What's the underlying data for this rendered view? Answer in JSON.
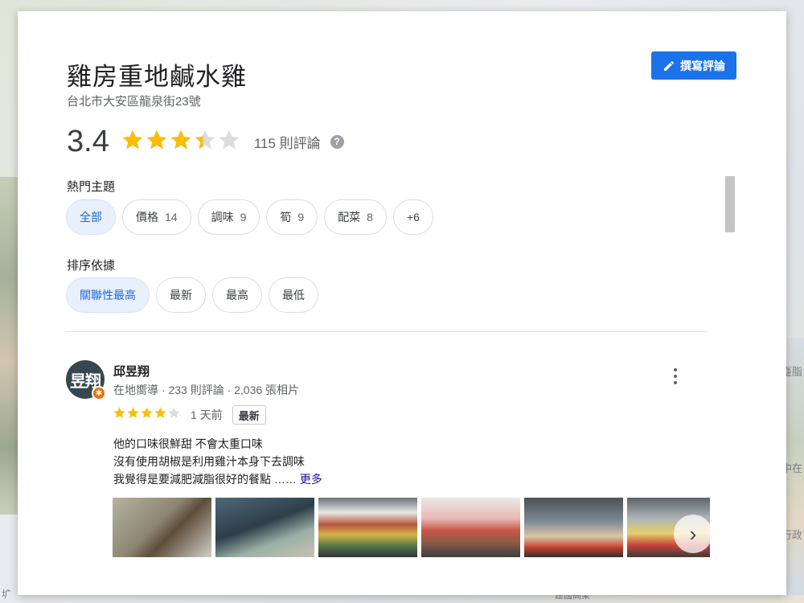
{
  "place": {
    "name": "雞房重地鹹水雞",
    "address": "台北市大安區龍泉街23號",
    "rating": "3.4",
    "rating_value": 3.4,
    "review_count": "115 則評論",
    "write_review_label": "撰寫評論"
  },
  "topics": {
    "label": "熱門主題",
    "chips": [
      {
        "label": "全部",
        "count": "",
        "active": true
      },
      {
        "label": "價格",
        "count": "14",
        "active": false
      },
      {
        "label": "調味",
        "count": "9",
        "active": false
      },
      {
        "label": "筍",
        "count": "9",
        "active": false
      },
      {
        "label": "配菜",
        "count": "8",
        "active": false
      },
      {
        "label": "+6",
        "count": "",
        "active": false
      }
    ]
  },
  "sort": {
    "label": "排序依據",
    "chips": [
      {
        "label": "關聯性最高",
        "active": true
      },
      {
        "label": "最新",
        "active": false
      },
      {
        "label": "最高",
        "active": false
      },
      {
        "label": "最低",
        "active": false
      }
    ]
  },
  "review": {
    "avatar_text": "昱翔",
    "reviewer_name": "邱昱翔",
    "reviewer_meta": "在地嚮導 · 233 則評論 · 2,036 張相片",
    "stars": 4,
    "time": "1 天前",
    "badge": "最新",
    "lines": [
      "他的口味很鮮甜 不會太重口味",
      "沒有使用胡椒是利用雞汁本身下去調味",
      "我覺得是要減肥減脂很好的餐點 ……"
    ],
    "more_link": "更多"
  },
  "background": {
    "right_labels": [
      "臺脂",
      "中在",
      "行政"
    ],
    "left_label": "圹",
    "bottom_label": "建國高架"
  },
  "colors": {
    "accent": "#1a73e8",
    "star": "#fbbc04",
    "chip_active_bg": "#e8f0fe"
  }
}
